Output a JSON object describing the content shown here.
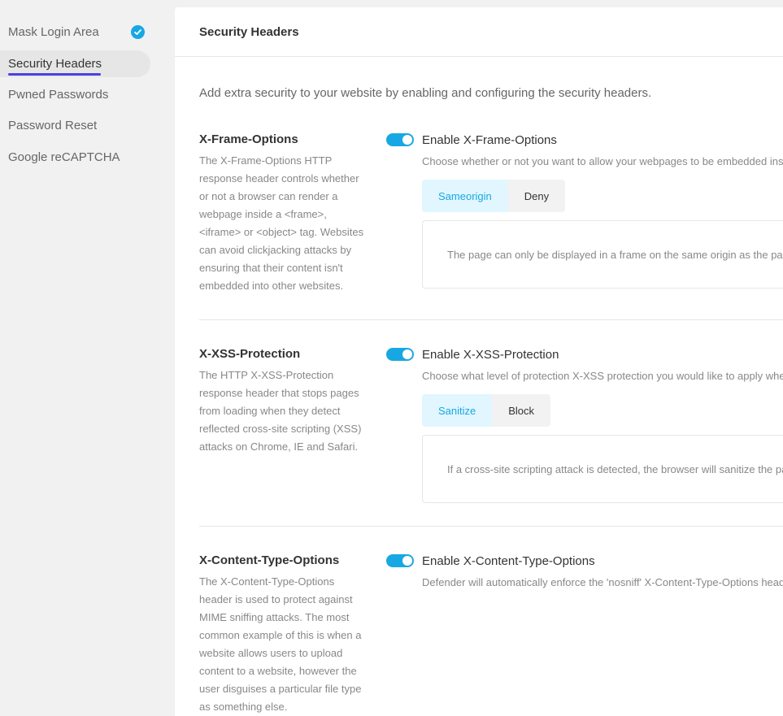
{
  "sidebar": {
    "items": [
      {
        "label": "Mask Login Area"
      },
      {
        "label": "Security Headers"
      },
      {
        "label": "Pwned Passwords"
      },
      {
        "label": "Password Reset"
      },
      {
        "label": "Google reCAPTCHA"
      }
    ]
  },
  "header": {
    "title": "Security Headers"
  },
  "intro": "Add extra security to your website by enabling and configuring the security headers.",
  "sections": [
    {
      "title": "X-Frame-Options",
      "description": "The X-Frame-Options HTTP response header controls whether or not a browser can render a webpage inside a <frame>, <iframe> or <object> tag. Websites can avoid clickjacking attacks by ensuring that their content isn't embedded into other websites.",
      "toggle_label": "Enable X-Frame-Options",
      "field_desc": "Choose whether or not you want to allow your webpages to be embedded inside",
      "tabs": [
        "Sameorigin",
        "Deny"
      ],
      "panel_text": "The page can only be displayed in a frame on the same origin as the page it"
    },
    {
      "title": "X-XSS-Protection",
      "description": "The HTTP X-XSS-Protection response header that stops pages from loading when they detect reflected cross-site scripting (XSS) attacks on Chrome, IE and Safari.",
      "toggle_label": "Enable X-XSS-Protection",
      "field_desc": "Choose what level of protection X-XSS protection you would like to apply when XS",
      "tabs": [
        "Sanitize",
        "Block"
      ],
      "panel_text": "If a cross-site scripting attack is detected, the browser will sanitize the page"
    },
    {
      "title": "X-Content-Type-Options",
      "description": "The X-Content-Type-Options header is used to protect against MIME sniffing attacks. The most common example of this is when a website allows users to upload content to a website, however the user disguises a particular file type as something else.",
      "toggle_label": "Enable X-Content-Type-Options",
      "field_desc": "Defender will automatically enforce the 'nosniff' X-Content-Type-Options header t"
    }
  ],
  "colors": {
    "accent": "#17a8e3",
    "active_underline": "#4c3fe0"
  }
}
